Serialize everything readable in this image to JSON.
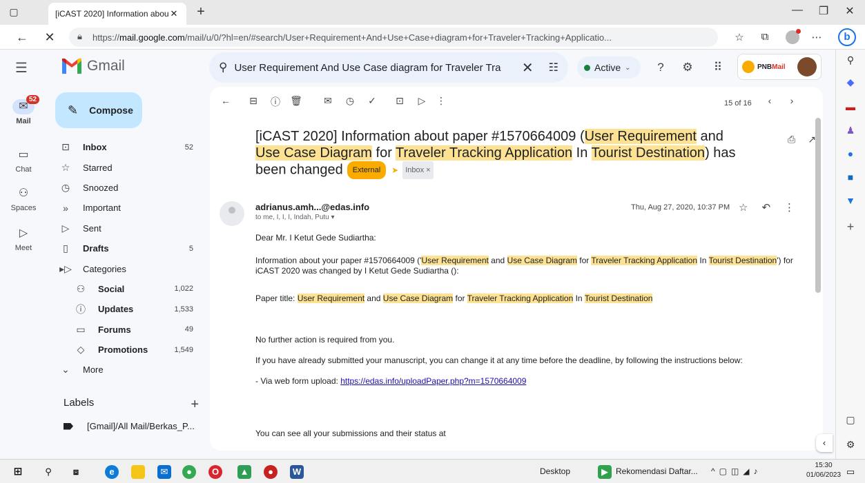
{
  "browser": {
    "tab_title": "[iCAST 2020] Information about",
    "url_prefix": "https://",
    "url_host": "mail.google.com",
    "url_path": "/mail/u/0/?hl=en/#search/User+Requirement+And+Use+Case+diagram+for+Traveler+Tracking+Applicatio..."
  },
  "gmail": {
    "app_name": "Gmail",
    "search_value": "User Requirement And Use Case diagram for Traveler Tra",
    "status_label": "Active",
    "account_brand_prefix": "PNB",
    "account_brand_suffix": "Mail"
  },
  "rail": {
    "mail_badge": "52",
    "mail": "Mail",
    "chat": "Chat",
    "spaces": "Spaces",
    "meet": "Meet"
  },
  "compose_label": "Compose",
  "nav": {
    "inbox": {
      "label": "Inbox",
      "count": "52"
    },
    "starred": {
      "label": "Starred"
    },
    "snoozed": {
      "label": "Snoozed"
    },
    "important": {
      "label": "Important"
    },
    "sent": {
      "label": "Sent"
    },
    "drafts": {
      "label": "Drafts",
      "count": "5"
    },
    "categories": {
      "label": "Categories"
    },
    "social": {
      "label": "Social",
      "count": "1,022"
    },
    "updates": {
      "label": "Updates",
      "count": "1,533"
    },
    "forums": {
      "label": "Forums",
      "count": "49"
    },
    "promotions": {
      "label": "Promotions",
      "count": "1,549"
    },
    "more": {
      "label": "More"
    }
  },
  "labels": {
    "heading": "Labels",
    "item": "[Gmail]/All Mail/Berkas_P..."
  },
  "mail": {
    "pager": "15 of 16",
    "subject_a": "[iCAST 2020] Information about paper #1570664009 (",
    "subject_hl1": "User Requirement",
    "subject_b": " and ",
    "subject_hl2": "Use Case Diagram",
    "subject_c": " for ",
    "subject_hl3": "Traveler Tracking Application",
    "subject_d": " In ",
    "subject_hl4": "Tourist Destination",
    "subject_e": ") has been changed",
    "chip_external": "External",
    "chip_inbox": "Inbox ×",
    "sender": "adrianus.amh...@edas.info",
    "recipients": "to me, I, I, I, Indah, Putu",
    "date": "Thu, Aug 27, 2020, 10:37 PM",
    "greeting": "Dear Mr. I Ketut Gede Sudiartha:",
    "info_a": "Information about your paper #1570664009 ('",
    "info_hl1": "User Requirement",
    "info_b": " and ",
    "info_hl2": "Use Case Diagram",
    "info_c": " for ",
    "info_hl3": "Traveler Tracking Application",
    "info_d": " In ",
    "info_hl4": "Tourist Destination",
    "info_e": "') for iCAST 2020 was changed by I Ketut Gede Sudiartha ():",
    "title_a": "Paper title: ",
    "title_hl1": "User Requirement",
    "title_b": " and ",
    "title_hl2": "Use Case Diagram",
    "title_c": " for ",
    "title_hl3": "Traveler Tracking Application",
    "title_d": " In ",
    "title_hl4": "Tourist Destination",
    "no_action": "No further action is required from you.",
    "instructions": "If you have already submitted your manuscript, you can change it at any time before the deadline, by following the instructions below:",
    "upload_prefix": "- Via web form upload: ",
    "upload_link": "https://edas.info/uploadPaper.php?m=1570664009",
    "submissions": "You can see all your submissions and their status at"
  },
  "taskbar": {
    "desktop": "Desktop",
    "window": "Rekomendasi Daftar...",
    "time": "15:30",
    "date": "01/06/2023"
  },
  "colors": {
    "accent": "#1a73e8",
    "highlight": "#fde293",
    "external_chip": "#f9ab00",
    "compose_bg": "#c2e7ff",
    "badge": "#d93025"
  }
}
